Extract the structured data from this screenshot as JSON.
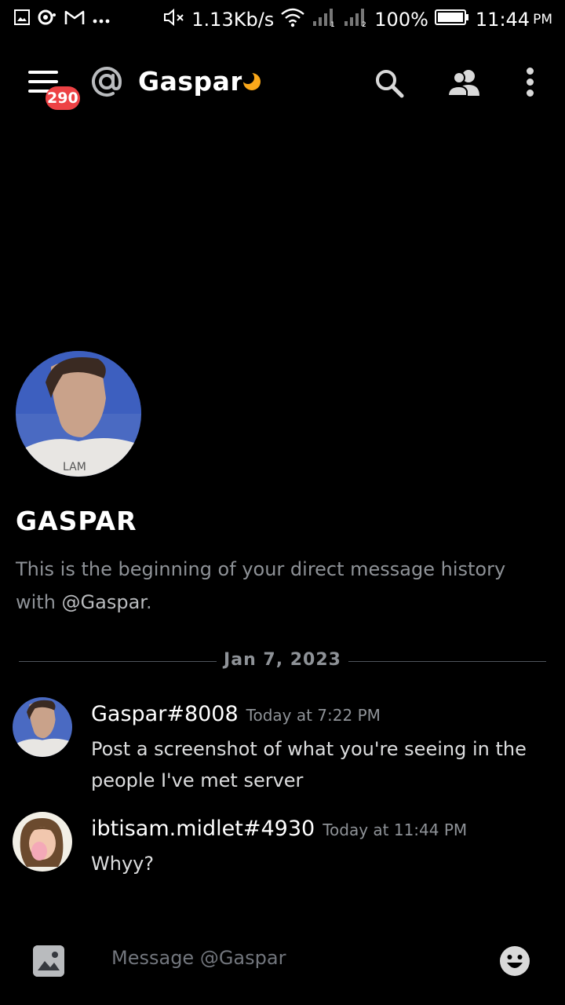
{
  "status_bar": {
    "left_icons": [
      "gallery-notification-icon",
      "discord-notification-icon",
      "gmail-icon",
      "more-notifications-icon"
    ],
    "speed": "1.13Kb/s",
    "battery": "100%",
    "time": "11:44",
    "ampm": "PM"
  },
  "header": {
    "notification_count": "290",
    "channel_name": "Gaspar",
    "status": "idle"
  },
  "intro": {
    "name": "GASPAR",
    "text_prefix": "This is the beginning of your direct message history with ",
    "mention": "@Gaspar",
    "text_suffix": "."
  },
  "divider": {
    "date": "Jan 7, 2023"
  },
  "messages": [
    {
      "author": "Gaspar#8008",
      "time": "Today at 7:22 PM",
      "text": "Post a screenshot of what you're seeing in the people I've met server"
    },
    {
      "author": "ibtisam.midlet#4930",
      "time": "Today at 11:44 PM",
      "text": "Whyy?"
    }
  ],
  "composer": {
    "placeholder": "Message @Gaspar"
  },
  "colors": {
    "background": "#000000",
    "badge": "#ed4245",
    "idle": "#faa81a",
    "muted_text": "#8e9297",
    "message_text": "#dcddde"
  }
}
